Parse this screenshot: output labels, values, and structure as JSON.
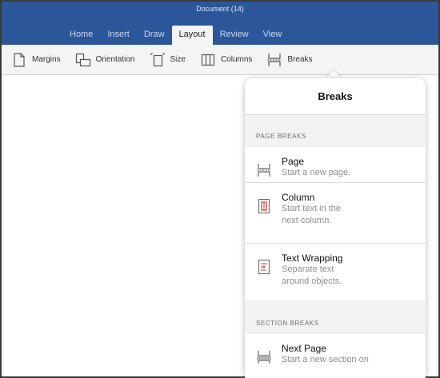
{
  "window": {
    "title": "Document (14)"
  },
  "tabs": [
    {
      "label": "Home"
    },
    {
      "label": "Insert"
    },
    {
      "label": "Draw"
    },
    {
      "label": "Layout",
      "active": true
    },
    {
      "label": "Review"
    },
    {
      "label": "View"
    }
  ],
  "ribbon": {
    "margins": {
      "label": "Margins",
      "icon": "margins-icon"
    },
    "orientation": {
      "label": "Orientation",
      "icon": "orientation-icon"
    },
    "size": {
      "label": "Size",
      "icon": "size-icon"
    },
    "columns": {
      "label": "Columns",
      "icon": "columns-icon"
    },
    "breaks": {
      "label": "Breaks",
      "icon": "breaks-icon"
    }
  },
  "popover": {
    "title": "Breaks",
    "page_breaks_header": "PAGE BREAKS",
    "section_breaks_header": "SECTION BREAKS",
    "items": [
      {
        "title": "Page",
        "subtitle": "Start a new page.",
        "icon": "page-break-icon"
      },
      {
        "title": "Column",
        "subtitle": "Start text in the\nnext column.",
        "icon": "column-break-icon"
      },
      {
        "title": "Text Wrapping",
        "subtitle": "Separate text\naround objects.",
        "icon": "text-wrapping-icon"
      },
      {
        "title": "Next Page",
        "subtitle": "Start a new section on",
        "icon": "next-page-icon"
      }
    ]
  },
  "colors": {
    "title_bar": "#2b579a",
    "ribbon": "#f4f4f4",
    "popover_bg": "#f2f2f4",
    "accent_red": "#c0392b"
  }
}
